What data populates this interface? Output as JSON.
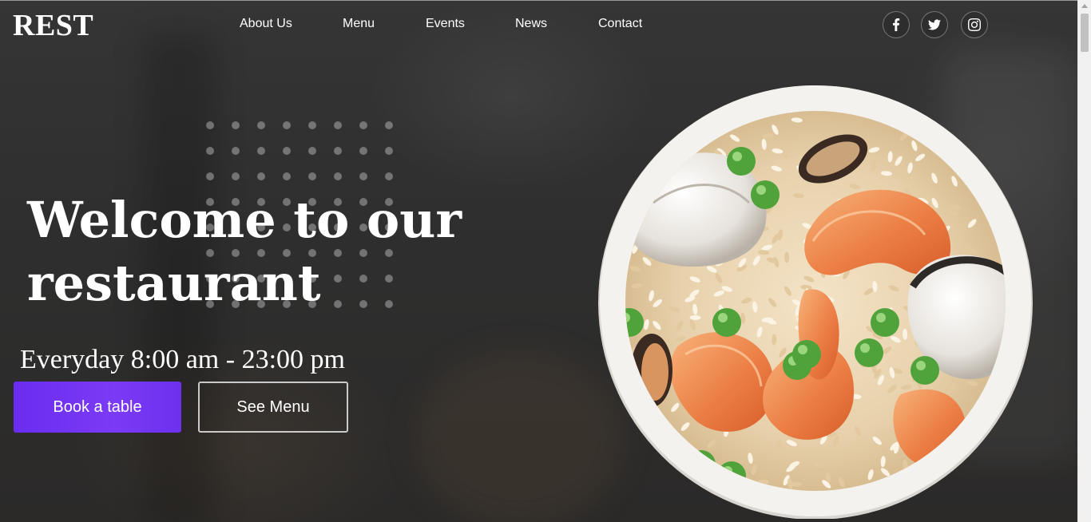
{
  "brand": {
    "logo": "REST"
  },
  "nav": {
    "items": [
      {
        "label": "About Us"
      },
      {
        "label": "Menu"
      },
      {
        "label": "Events"
      },
      {
        "label": "News"
      },
      {
        "label": "Contact"
      }
    ]
  },
  "social": {
    "icons": [
      "facebook-icon",
      "twitter-icon",
      "instagram-icon"
    ]
  },
  "hero": {
    "title_line1": "Welcome to our",
    "title_line2": "restaurant",
    "hours": "Everyday 8:00 am - 23:00 pm",
    "book_label": "Book a table",
    "menu_label": "See Menu"
  },
  "colors": {
    "accent": "#6a2cf0",
    "text": "#ffffff",
    "background": "#2e2e2e"
  }
}
